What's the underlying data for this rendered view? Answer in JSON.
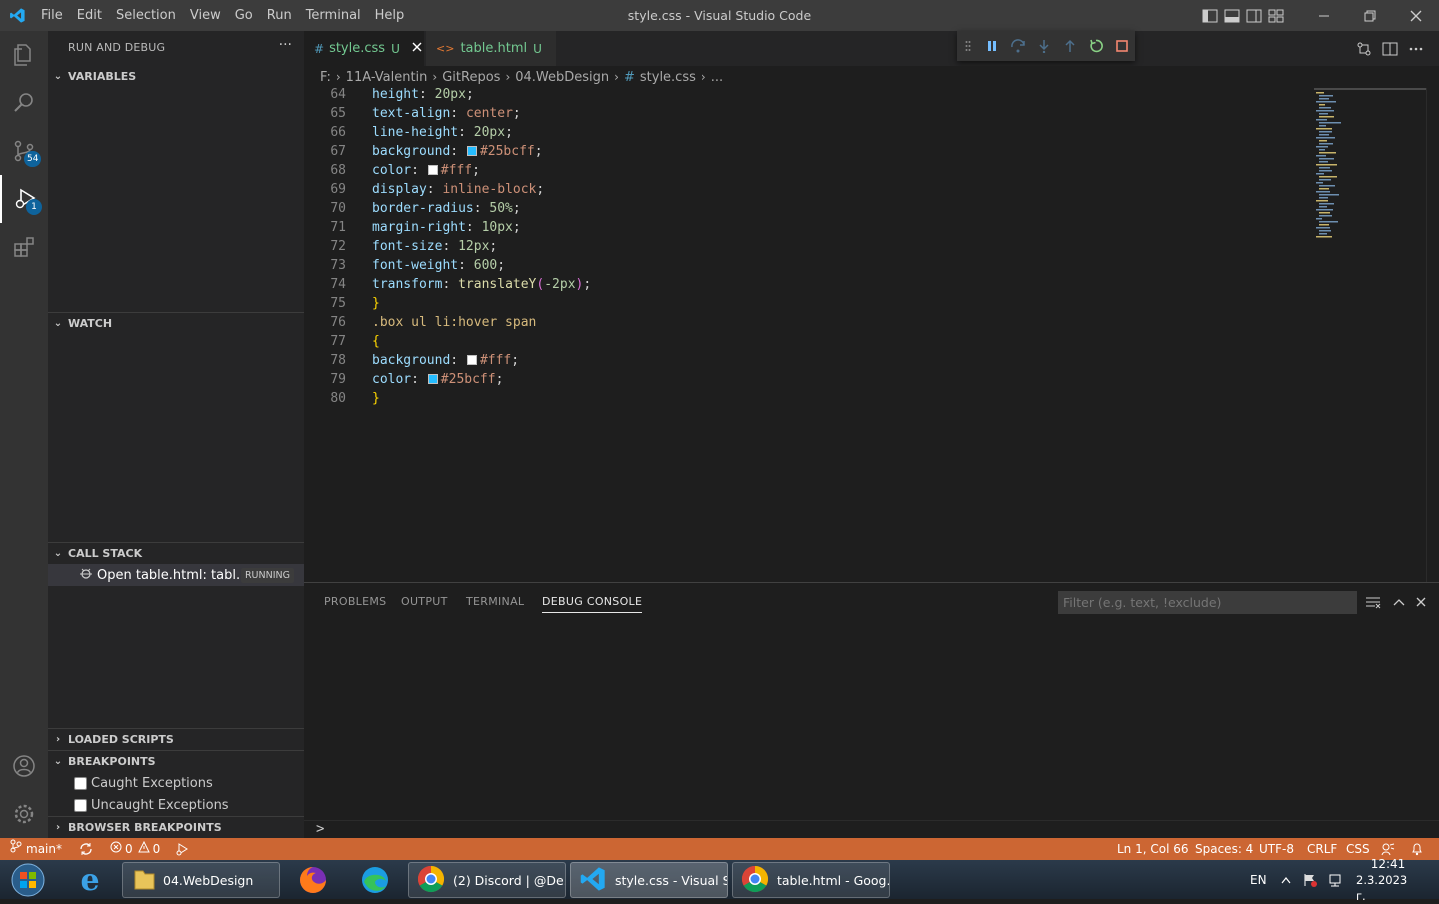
{
  "window": {
    "title": "style.css - Visual Studio Code",
    "menu": [
      "File",
      "Edit",
      "Selection",
      "View",
      "Go",
      "Run",
      "Terminal",
      "Help"
    ]
  },
  "activity_bar": {
    "source_control_badge": "54",
    "run_debug_badge": "1"
  },
  "sidebar": {
    "title": "RUN AND DEBUG",
    "more_label": "···",
    "sections": {
      "variables": "VARIABLES",
      "watch": "WATCH",
      "call_stack": "CALL STACK",
      "loaded_scripts": "LOADED SCRIPTS",
      "breakpoints": "BREAKPOINTS",
      "browser_breakpoints": "BROWSER BREAKPOINTS"
    },
    "call_stack_item": {
      "label": "Open table.html: tabl...",
      "status": "RUNNING"
    },
    "breakpoint_items": [
      {
        "label": "Caught Exceptions",
        "checked": false
      },
      {
        "label": "Uncaught Exceptions",
        "checked": false
      }
    ]
  },
  "tabs": [
    {
      "label": "style.css",
      "status": "U",
      "glyph": "#",
      "active": true
    },
    {
      "label": "table.html",
      "status": "U",
      "glyph": "<>",
      "active": false
    }
  ],
  "breadcrumb": [
    "F:",
    "11A-Valentin",
    "GitRepos",
    "04.WebDesign",
    "style.css",
    "..."
  ],
  "breadcrumb_glyph": "#",
  "code": [
    {
      "n": "64",
      "prop": "height",
      "value": "20px",
      "kind": "num"
    },
    {
      "n": "65",
      "prop": "text-align",
      "value": "center",
      "kind": "val"
    },
    {
      "n": "66",
      "prop": "line-height",
      "value": "20px",
      "kind": "num"
    },
    {
      "n": "67",
      "prop": "background",
      "value": "#25bcff",
      "kind": "color",
      "swatch": "#25bcff"
    },
    {
      "n": "68",
      "prop": "color",
      "value": "#fff",
      "kind": "color",
      "swatch": "#ffffff"
    },
    {
      "n": "69",
      "prop": "display",
      "value": "inline-block",
      "kind": "val"
    },
    {
      "n": "70",
      "prop": "border-radius",
      "value": "50%",
      "kind": "num"
    },
    {
      "n": "71",
      "prop": "margin-right",
      "value": "10px",
      "kind": "num"
    },
    {
      "n": "72",
      "prop": "font-size",
      "value": "12px",
      "kind": "num"
    },
    {
      "n": "73",
      "prop": "font-weight",
      "value": "600",
      "kind": "num"
    },
    {
      "n": "74",
      "prop": "transform",
      "value": "-2px",
      "kind": "fn",
      "fn": "translateY"
    },
    {
      "n": "75",
      "text": "}",
      "kind": "brace"
    },
    {
      "n": "76",
      "text": ".box ul li:hover span",
      "kind": "selector"
    },
    {
      "n": "77",
      "text": "{",
      "kind": "brace"
    },
    {
      "n": "78",
      "prop": "background",
      "value": "#fff",
      "kind": "color",
      "swatch": "#ffffff"
    },
    {
      "n": "79",
      "prop": "color",
      "value": "#25bcff",
      "kind": "color",
      "swatch": "#25bcff"
    },
    {
      "n": "80",
      "text": "}",
      "kind": "brace"
    }
  ],
  "panel": {
    "tabs": [
      "PROBLEMS",
      "OUTPUT",
      "TERMINAL",
      "DEBUG CONSOLE"
    ],
    "active_tab": "DEBUG CONSOLE",
    "filter_placeholder": "Filter (e.g. text, !exclude)",
    "prompt": ">"
  },
  "status_bar": {
    "branch": "main*",
    "errors": "0",
    "warnings": "0",
    "position": "Ln 1, Col 66",
    "spaces": "Spaces: 4",
    "encoding": "UTF-8",
    "eol": "CRLF",
    "language": "CSS"
  },
  "taskbar": {
    "items": [
      {
        "label": "04.WebDesign",
        "icon": "folder-icon"
      },
      {
        "label": "(2) Discord | @De...",
        "icon": "chrome-icon"
      },
      {
        "label": "style.css - Visual S...",
        "icon": "vscode-icon"
      },
      {
        "label": "table.html - Goog...",
        "icon": "chrome-icon"
      }
    ],
    "language": "EN",
    "time": "12:41",
    "date": "2.3.2023 г."
  },
  "colors": {
    "statusbar": "#cc6633",
    "accent": "#0e639c",
    "swatch_blue": "#25bcff"
  }
}
